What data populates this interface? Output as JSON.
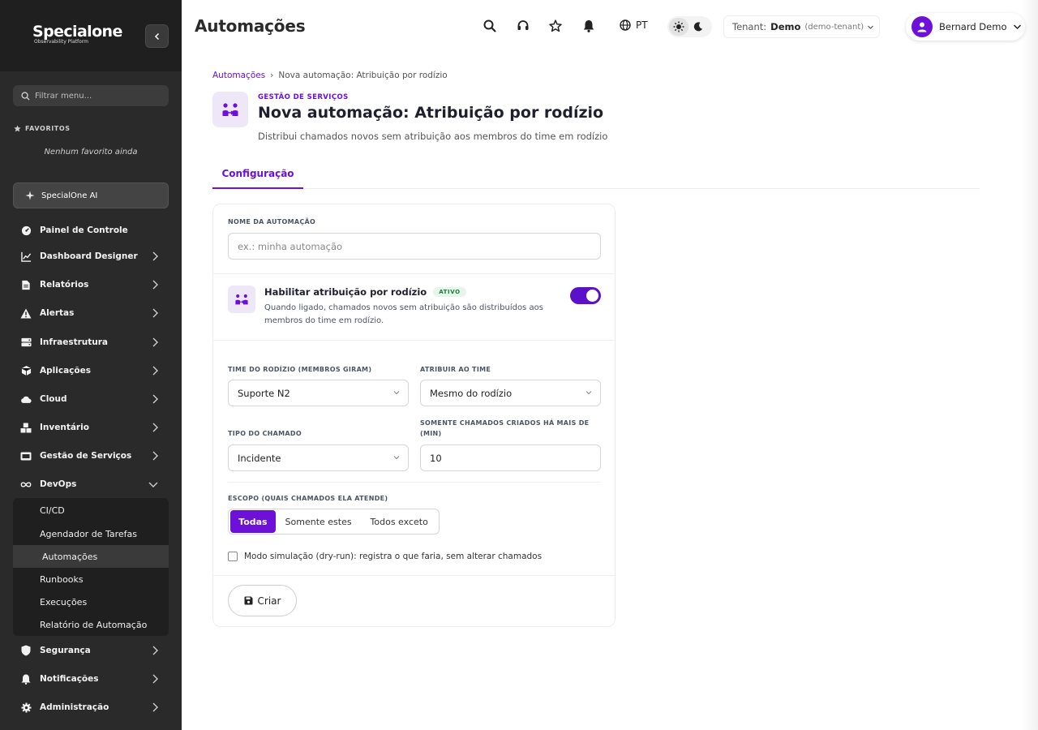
{
  "brand": {
    "name": "Specialone",
    "tagline": "Observability Platform"
  },
  "sidebar": {
    "search_placeholder": "Filtrar menu...",
    "favorites_title": "FAVORITOS",
    "favorites_empty": "Nenhum favorito ainda",
    "ai_label": "SpecialOne AI",
    "items": [
      {
        "label": "Painel de Controle",
        "icon": "gauge-icon"
      },
      {
        "label": "Dashboard Designer",
        "icon": "chart-line-icon"
      },
      {
        "label": "Relatórios",
        "icon": "file-icon"
      },
      {
        "label": "Alertas",
        "icon": "warning-icon"
      },
      {
        "label": "Infraestrutura",
        "icon": "server-icon"
      },
      {
        "label": "Aplicações",
        "icon": "cube-icon"
      },
      {
        "label": "Cloud",
        "icon": "cloud-icon"
      },
      {
        "label": "Inventário",
        "icon": "boxes-icon"
      },
      {
        "label": "Gestão de Serviços",
        "icon": "tickets-icon"
      },
      {
        "label": "DevOps",
        "icon": "infinity-icon"
      },
      {
        "label": "Segurança",
        "icon": "shield-icon"
      },
      {
        "label": "Notificações",
        "icon": "bell-icon"
      },
      {
        "label": "Administração",
        "icon": "gear-icon"
      }
    ],
    "devops_sub": [
      "CI/CD",
      "Agendador de Tarefas",
      "Automações",
      "Runbooks",
      "Execuções",
      "Relatório de Automação"
    ]
  },
  "header": {
    "title": "Automações",
    "lang": "PT",
    "tenant_label": "Tenant:",
    "tenant_value": "Demo",
    "tenant_id": "(demo-tenant)",
    "user_name": "Bernard Demo"
  },
  "breadcrumb": {
    "root": "Automações",
    "sep": "›",
    "current": "Nova automação: Atribuição por rodízio"
  },
  "page": {
    "kicker": "GESTÃO DE SERVIÇOS",
    "title": "Nova automação: Atribuição por rodízio",
    "subtitle": "Distribui chamados novos sem atribuição aos membros do time em rodízio",
    "tab": "Configuração"
  },
  "form": {
    "name_label": "NOME DA AUTOMAÇÃO",
    "name_placeholder": "ex.: minha automação",
    "toggle_title": "Habilitar atribuição por rodízio",
    "toggle_badge": "ATIVO",
    "toggle_desc": "Quando ligado, chamados novos sem atribuição são distribuídos aos membros do time em rodízio.",
    "toggle_on": true,
    "team_label": "TIME DO RODÍZIO (MEMBROS GIRAM)",
    "team_value": "Suporte N2",
    "assign_label": "ATRIBUIR AO TIME",
    "assign_value": "Mesmo do rodízio",
    "type_label": "TIPO DO CHAMADO",
    "type_value": "Incidente",
    "age_label": "SOMENTE CHAMADOS CRIADOS HÁ MAIS DE (MIN)",
    "age_value": "10",
    "scope_label": "ESCOPO (QUAIS CHAMADOS ELA ATENDE)",
    "scope_options": [
      "Todas",
      "Somente estes",
      "Todos exceto"
    ],
    "dry_run_label": "Modo simulação (dry-run): registra o que faria, sem alterar chamados",
    "create_label": "Criar"
  },
  "colors": {
    "accent": "#6d10d8",
    "sidebar_bg": "#2a2a2a",
    "success": "#15803d"
  }
}
